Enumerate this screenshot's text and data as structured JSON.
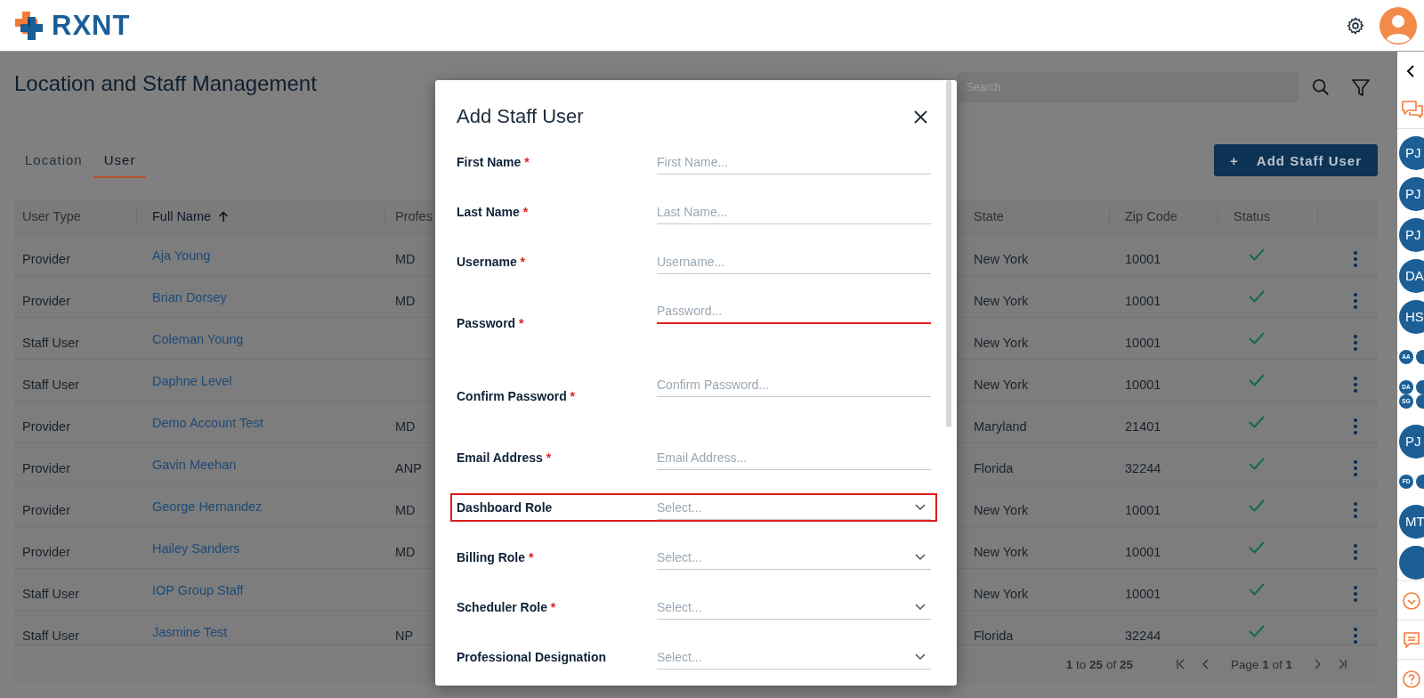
{
  "header": {
    "logo_text": "RXNT"
  },
  "page": {
    "title": "Location and Staff Management",
    "search": {
      "placeholder": "Search"
    },
    "tabs": [
      {
        "label": "Location",
        "selected": false
      },
      {
        "label": "User",
        "selected": true
      }
    ],
    "add_button": {
      "icon": "+",
      "label": "Add Staff User"
    }
  },
  "table": {
    "columns": [
      {
        "label": "User Type",
        "sorted": false
      },
      {
        "label": "Full Name",
        "sorted": true
      },
      {
        "label": "Profes",
        "sorted": false
      },
      {
        "label": "State",
        "sorted": false
      },
      {
        "label": "Zip Code",
        "sorted": false
      },
      {
        "label": "Status",
        "sorted": false
      }
    ],
    "rows": [
      {
        "user_type": "Provider",
        "full_name": "Aja Young",
        "column_3": "MD",
        "state": "New York",
        "zip_code": "10001",
        "active": true
      },
      {
        "user_type": "Provider",
        "full_name": "Brian Dorsey",
        "column_3": "MD",
        "state": "New York",
        "zip_code": "10001",
        "active": true
      },
      {
        "user_type": "Staff User",
        "full_name": "Coleman Young",
        "state": "New York",
        "zip_code": "10001",
        "active": true
      },
      {
        "user_type": "Staff User",
        "full_name": "Daphne Level",
        "state": "New York",
        "zip_code": "10001",
        "active": true
      },
      {
        "user_type": "Provider",
        "full_name": "Demo Account Test",
        "column_3": "MD",
        "state": "Maryland",
        "zip_code": "21401",
        "active": true
      },
      {
        "user_type": "Provider",
        "full_name": "Gavin Meehan",
        "column_3": "ANP",
        "state": "Florida",
        "zip_code": "32244",
        "active": true
      },
      {
        "user_type": "Provider",
        "full_name": "George Hernandez",
        "column_3": "MD",
        "state": "New York",
        "zip_code": "10001",
        "active": true
      },
      {
        "user_type": "Provider",
        "full_name": "Hailey Sanders",
        "column_3": "MD",
        "state": "New York",
        "zip_code": "10001",
        "active": true
      },
      {
        "user_type": "Staff User",
        "full_name": "IOP Group Staff",
        "state": "New York",
        "zip_code": "10001",
        "active": true
      },
      {
        "user_type": "Staff User",
        "full_name": "Jasmine Test",
        "column_3": "NP",
        "state": "Florida",
        "zip_code": "32244",
        "active": true
      }
    ],
    "pagination": {
      "range": "**1** to **25** of **25**",
      "page": "Page **1** of **1**"
    }
  },
  "modal": {
    "title": "Add Staff User",
    "fields": [
      {
        "label": "First Name",
        "required_mark": "*",
        "kind": "text",
        "placeholder": "First Name...",
        "error": false,
        "highlighted": false
      },
      {
        "label": "Last Name",
        "required_mark": "*",
        "kind": "text",
        "placeholder": "Last Name...",
        "error": false,
        "highlighted": false
      },
      {
        "label": "Username",
        "required_mark": "*",
        "kind": "text",
        "placeholder": "Username...",
        "error": false,
        "highlighted": false
      },
      {
        "label": "Password",
        "required_mark": "*",
        "kind": "password",
        "placeholder": "Password...",
        "error": true,
        "highlighted": false
      },
      {
        "label": "Confirm Password",
        "required_mark": "*",
        "kind": "password",
        "placeholder": "Confirm Password...",
        "error": false,
        "highlighted": false
      },
      {
        "label": "Email Address",
        "required_mark": "*",
        "kind": "text",
        "placeholder": "Email Address...",
        "error": false,
        "highlighted": false
      },
      {
        "label": "Dashboard Role",
        "kind": "select",
        "placeholder": "Select...",
        "error": false,
        "highlighted": true
      },
      {
        "label": "Billing Role",
        "required_mark": "*",
        "kind": "select",
        "placeholder": "Select...",
        "error": false,
        "highlighted": false
      },
      {
        "label": "Scheduler Role",
        "required_mark": "*",
        "kind": "select",
        "placeholder": "Select...",
        "error": false,
        "highlighted": false
      },
      {
        "label": "Professional Designation",
        "kind": "select",
        "placeholder": "Select...",
        "error": false,
        "highlighted": false
      }
    ]
  },
  "sidebar": {
    "avatars": [
      {
        "kind": "single",
        "initials": "PJ"
      },
      {
        "kind": "single",
        "initials": "PJ"
      },
      {
        "kind": "single",
        "initials": "PJ"
      },
      {
        "kind": "single",
        "initials": "DA"
      },
      {
        "kind": "single",
        "initials": "HS"
      },
      {
        "kind": "group",
        "members": [
          "AA"
        ],
        "overflow": true
      },
      {
        "kind": "group",
        "members": [
          "DA",
          "SG"
        ],
        "overflow": true
      },
      {
        "kind": "single",
        "initials": "PJ"
      },
      {
        "kind": "group",
        "members": [
          "FD"
        ],
        "overflow": true
      },
      {
        "kind": "single",
        "initials": "MT"
      },
      {
        "kind": "single"
      }
    ]
  }
}
